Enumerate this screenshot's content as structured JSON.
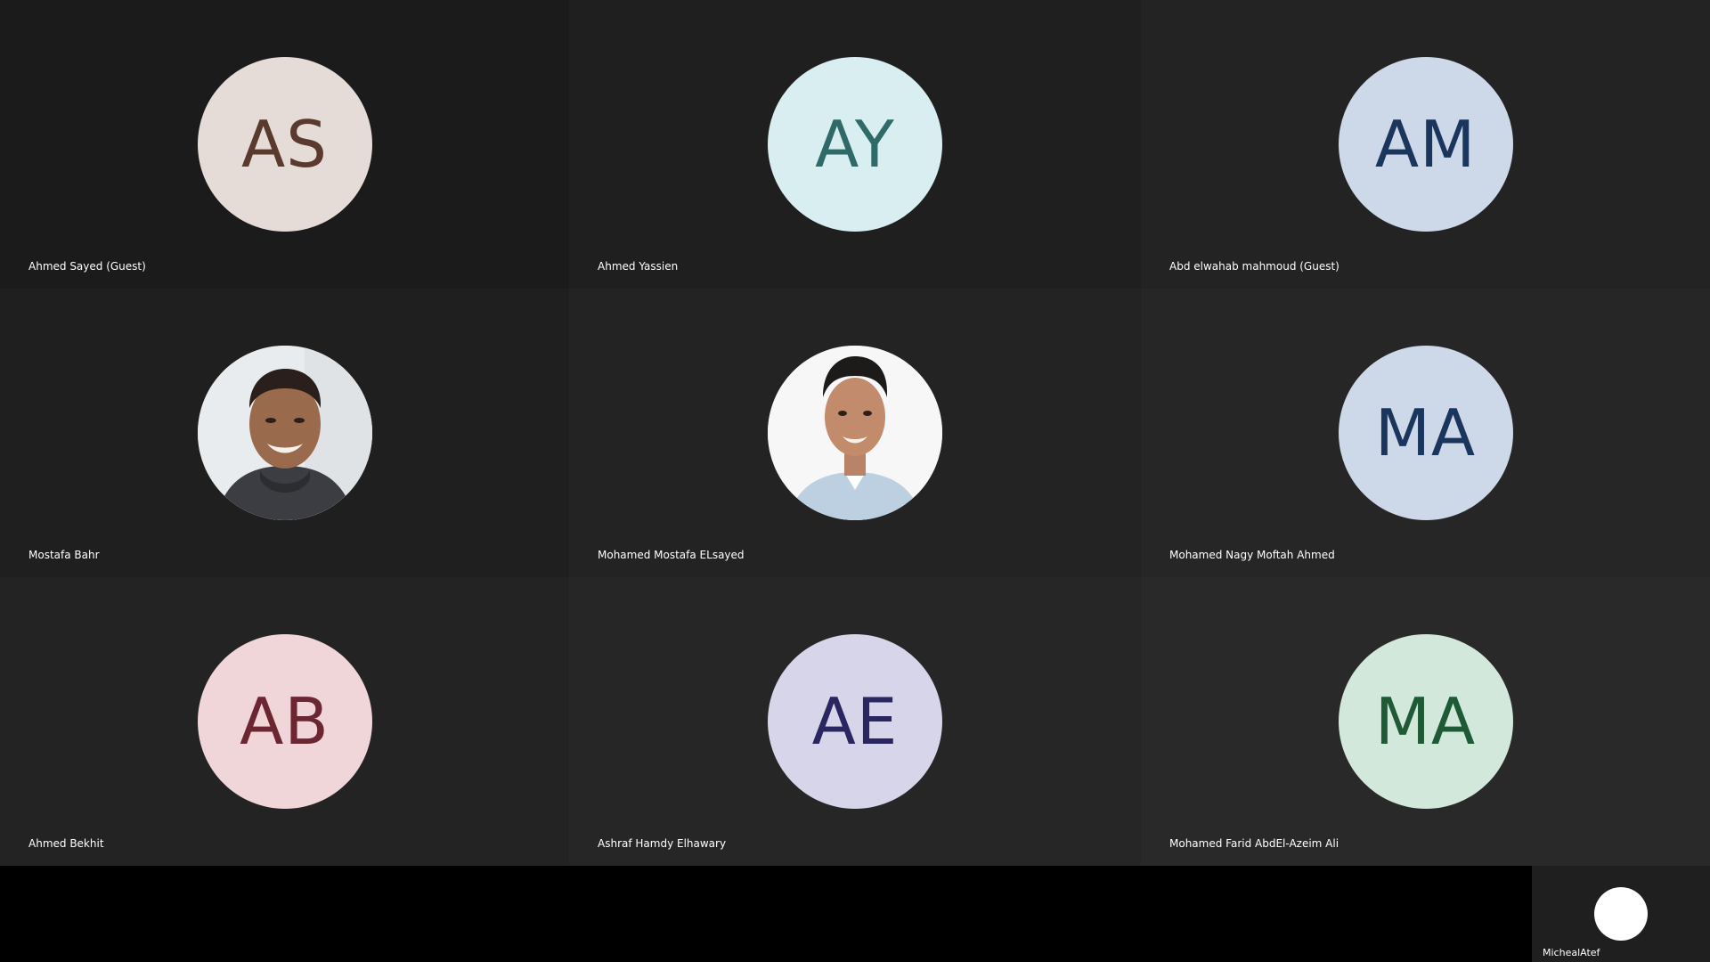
{
  "participants": [
    {
      "name": "Ahmed Sayed (Guest)",
      "initials": "AS",
      "avatar_bg": "#e6dcd7",
      "avatar_fg": "#5a3a2e"
    },
    {
      "name": "Ahmed Yassien",
      "initials": "AY",
      "avatar_bg": "#d9eef0",
      "avatar_fg": "#2f6a68"
    },
    {
      "name": "Abd elwahab mahmoud (Guest)",
      "initials": "AM",
      "avatar_bg": "#cdd8e8",
      "avatar_fg": "#1a365d"
    },
    {
      "name": "Mostafa Bahr",
      "initials": "",
      "avatar_type": "photo"
    },
    {
      "name": "Mohamed Mostafa ELsayed",
      "initials": "",
      "avatar_type": "photo"
    },
    {
      "name": "Mohamed Nagy Moftah Ahmed",
      "initials": "MA",
      "avatar_bg": "#cdd8e8",
      "avatar_fg": "#1a365d"
    },
    {
      "name": "Ahmed Bekhit",
      "initials": "AB",
      "avatar_bg": "#f0d6d8",
      "avatar_fg": "#6b2631"
    },
    {
      "name": "Ashraf Hamdy Elhawary",
      "initials": "AE",
      "avatar_bg": "#d6d5ea",
      "avatar_fg": "#2a2660"
    },
    {
      "name": "Mohamed Farid AbdEl-Azeim Ali",
      "initials": "MA",
      "avatar_bg": "#d1e8da",
      "avatar_fg": "#1e5a36"
    }
  ],
  "self_view": {
    "name": "MichealAtef",
    "avatar_bg": "#ffffff"
  }
}
